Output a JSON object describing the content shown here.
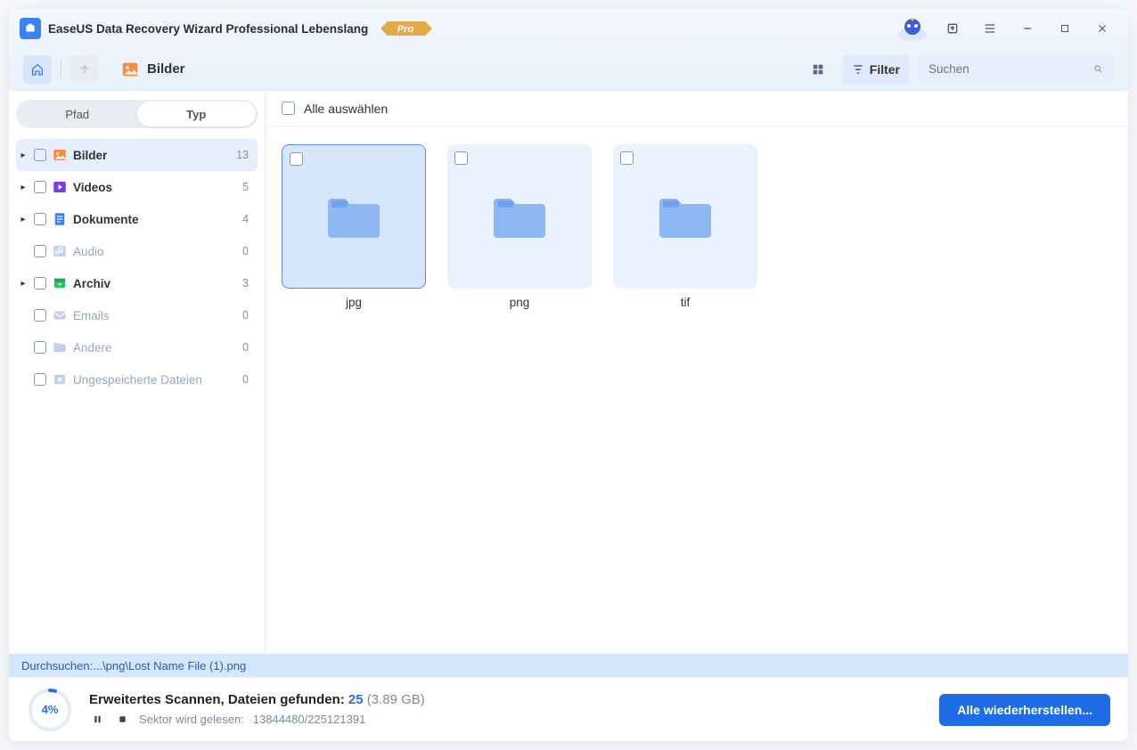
{
  "app": {
    "title": "EaseUS Data Recovery Wizard Professional Lebenslang",
    "badge": "Pro"
  },
  "toolbar": {
    "breadcrumb": "Bilder",
    "filter_label": "Filter",
    "search_placeholder": "Suchen"
  },
  "sidebar": {
    "tab_path": "Pfad",
    "tab_type": "Typ",
    "items": [
      {
        "label": "Bilder",
        "count": "13",
        "icon": "image",
        "color": "#ff8a3d",
        "expandable": true,
        "selected": true
      },
      {
        "label": "Videos",
        "count": "5",
        "icon": "video",
        "color": "#7c3aed",
        "expandable": true
      },
      {
        "label": "Dokumente",
        "count": "4",
        "icon": "doc",
        "color": "#3b82f6",
        "expandable": true
      },
      {
        "label": "Audio",
        "count": "0",
        "icon": "audio",
        "color": "#fb7185",
        "expandable": false,
        "muted": true
      },
      {
        "label": "Archiv",
        "count": "3",
        "icon": "archive",
        "color": "#22c55e",
        "expandable": true
      },
      {
        "label": "Emails",
        "count": "0",
        "icon": "mail",
        "color": "#60c3f0",
        "expandable": false,
        "muted": true
      },
      {
        "label": "Andere",
        "count": "0",
        "icon": "folder",
        "color": "#9ab6e0",
        "expandable": false,
        "muted": true
      },
      {
        "label": "Ungespeicherte Dateien",
        "count": "0",
        "icon": "unsaved",
        "color": "#9ab6e0",
        "expandable": false,
        "muted": true
      }
    ]
  },
  "main": {
    "select_all": "Alle auswählen",
    "folders": [
      {
        "name": "jpg",
        "selected": true
      },
      {
        "name": "png",
        "selected": false
      },
      {
        "name": "tif",
        "selected": false
      }
    ]
  },
  "status": {
    "browsing_label": "Durchsuchen: ",
    "browsing_path": "...\\png\\Lost Name File (1).png"
  },
  "footer": {
    "progress_pct": "4%",
    "line1_prefix": "Erweitertes Scannen, Dateien gefunden: ",
    "found_count": "25",
    "found_size": "(3.89 GB)",
    "sector_label": "Sektor wird gelesen: ",
    "sector_value": "13844480/225121391",
    "restore_label": "Alle wiederherstellen..."
  }
}
